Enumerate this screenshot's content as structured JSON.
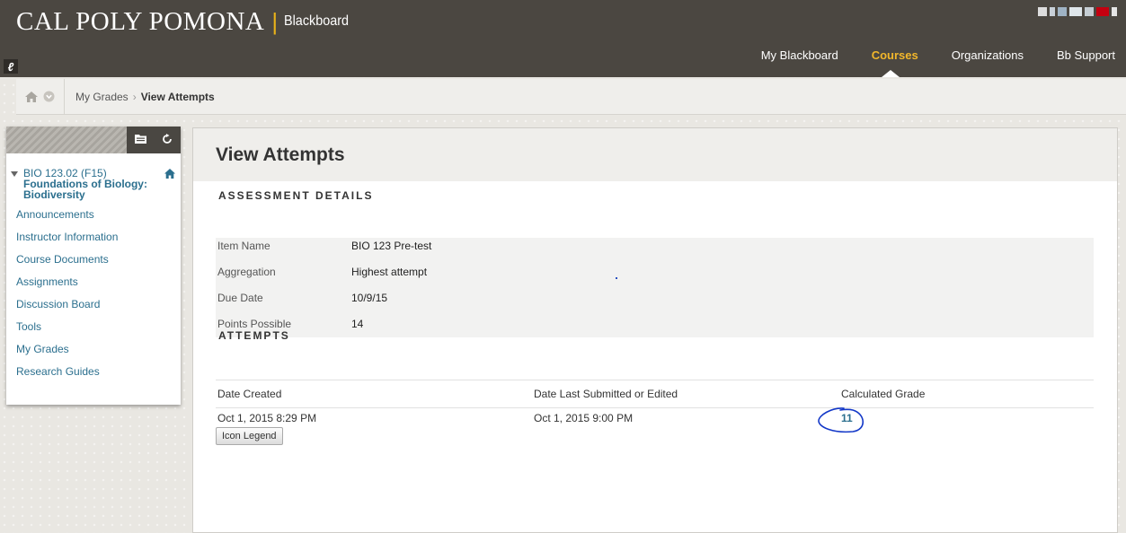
{
  "header": {
    "brand_main": "CAL POLY POMONA",
    "brand_sep": "|",
    "brand_sub": "Blackboard",
    "nav": [
      {
        "label": "My Blackboard",
        "active": false
      },
      {
        "label": "Courses",
        "active": true
      },
      {
        "label": "Organizations",
        "active": false
      },
      {
        "label": "Bb Support",
        "active": false
      }
    ],
    "colors": {
      "bar": "#4b4741",
      "accent": "#f2b72b"
    }
  },
  "breadcrumb": {
    "items": [
      "My Grades",
      "View Attempts"
    ],
    "separator": "›"
  },
  "sidebar": {
    "course_title_lines": [
      "BIO 123.02 (F15)",
      "Foundations of Biology:",
      "Biodiversity"
    ],
    "items": [
      {
        "label": "Announcements"
      },
      {
        "label": "Instructor Information"
      },
      {
        "label": "Course Documents"
      },
      {
        "label": "Assignments"
      },
      {
        "label": "Discussion Board"
      },
      {
        "label": "Tools"
      },
      {
        "label": "My Grades"
      },
      {
        "label": "Research Guides"
      }
    ],
    "link_color": "#2b6f8e"
  },
  "main": {
    "title": "View Attempts",
    "assessment_heading": "ASSESSMENT DETAILS",
    "details": [
      {
        "label": "Item Name",
        "value": "BIO 123 Pre-test"
      },
      {
        "label": "Aggregation",
        "value": "Highest attempt"
      },
      {
        "label": "Due Date",
        "value": "10/9/15"
      },
      {
        "label": "Points Possible",
        "value": "14"
      }
    ],
    "attempts_heading": "ATTEMPTS",
    "columns": [
      "Date Created",
      "Date Last Submitted or Edited",
      "Calculated Grade"
    ],
    "rows": [
      {
        "created": "Oct 1, 2015 8:29 PM",
        "submitted": "Oct 1, 2015 9:00 PM",
        "grade": "11"
      }
    ],
    "icon_legend_label": "Icon Legend"
  }
}
